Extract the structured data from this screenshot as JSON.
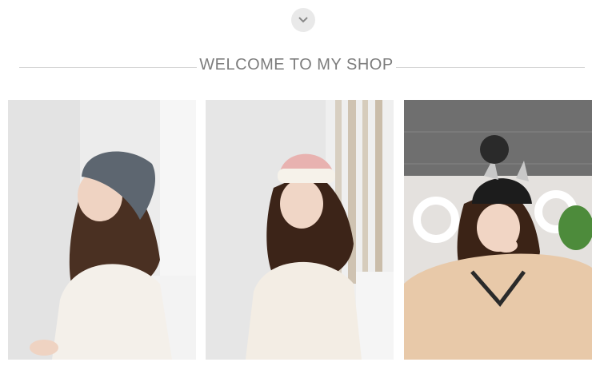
{
  "header": {
    "collapse_icon": "chevron-down-icon",
    "title": "WELCOME TO MY SHOP"
  },
  "gallery": {
    "photos": [
      {
        "name": "model-grey-slouchy-beanie"
      },
      {
        "name": "model-pink-cuffed-beanie"
      },
      {
        "name": "model-black-cat-ear-pompom-beanie"
      }
    ]
  },
  "colors": {
    "title_text": "#7d7d7d",
    "divider": "#d6d6d6",
    "chevron_bg": "#e9e9e9"
  }
}
